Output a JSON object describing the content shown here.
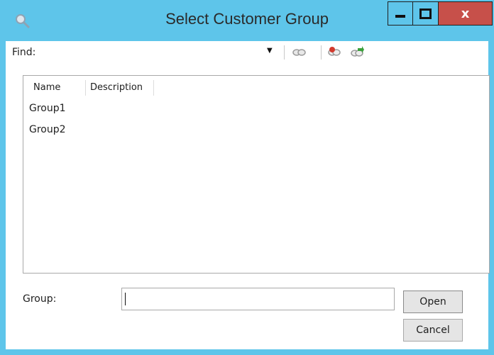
{
  "window": {
    "title": "Select Customer Group",
    "close_label": "x"
  },
  "find": {
    "label": "Find:",
    "value": ""
  },
  "toolbar": {
    "icons": [
      "search-icon",
      "filter-red-icon",
      "filter-green-icon"
    ]
  },
  "list": {
    "columns": [
      "Name",
      "Description"
    ],
    "rows": [
      {
        "name": "Group1",
        "description": ""
      },
      {
        "name": "Group2",
        "description": ""
      }
    ]
  },
  "group": {
    "label": "Group:",
    "value": ""
  },
  "buttons": {
    "open": "Open",
    "cancel": "Cancel"
  },
  "colors": {
    "titlebar": "#5ec5ea",
    "close_button": "#c7504a"
  }
}
